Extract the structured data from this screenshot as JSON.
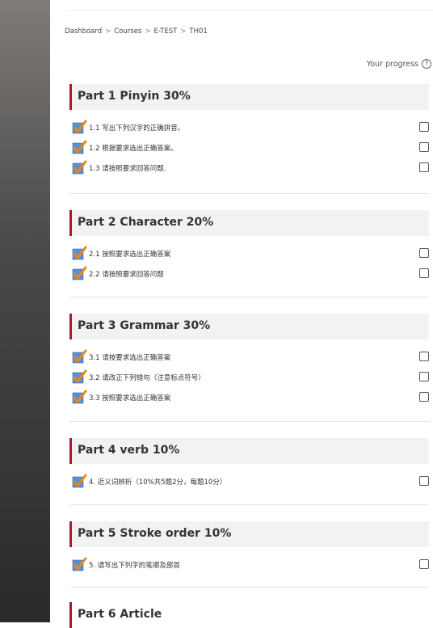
{
  "breadcrumb": [
    "Dashboard",
    "Courses",
    "E-TEST",
    "TH01"
  ],
  "breadcrumb_sep": ">",
  "progress_label": "Your progress",
  "help_icon": "question-circle-icon",
  "sections": [
    {
      "title": "Part 1 Pinyin 30%",
      "activities": [
        {
          "label": "1.1 写出下列汉字的正确拼音。",
          "icon": "quiz-check-icon"
        },
        {
          "label": "1.2 根据要求选出正确答案。",
          "icon": "quiz-check-icon"
        },
        {
          "label": "1.3 请按照要求回答问题.",
          "icon": "quiz-check-icon"
        }
      ]
    },
    {
      "title": "Part 2 Character 20%",
      "activities": [
        {
          "label": "2.1 按照要求选出正确答案",
          "icon": "quiz-check-icon"
        },
        {
          "label": "2.2 请按照要求回答问题",
          "icon": "quiz-check-icon"
        }
      ]
    },
    {
      "title": "Part 3 Grammar 30%",
      "activities": [
        {
          "label": "3.1 请按要求选出正确答案",
          "icon": "quiz-check-icon"
        },
        {
          "label": "3.2 请改正下列错句（注意标点符号）",
          "icon": "quiz-check-icon"
        },
        {
          "label": "3.3 按照要求选出正确答案",
          "icon": "quiz-check-icon"
        }
      ]
    },
    {
      "title": "Part 4 verb 10%",
      "activities": [
        {
          "label": "4. 近义词辨析（10%共5题2分，每题10分）",
          "icon": "quiz-check-icon"
        }
      ]
    },
    {
      "title": "Part 5 Stroke order 10%",
      "activities": [
        {
          "label": "5. 请写出下列字的笔顺及部首",
          "icon": "quiz-check-icon"
        }
      ]
    },
    {
      "title": "Part 6 Article",
      "activities": []
    }
  ],
  "colors": {
    "accent": "#b0192a",
    "section_bg": "#f2f2f2",
    "check_orange": "#e8881a",
    "quiz_blue": "#5b8fd0"
  }
}
